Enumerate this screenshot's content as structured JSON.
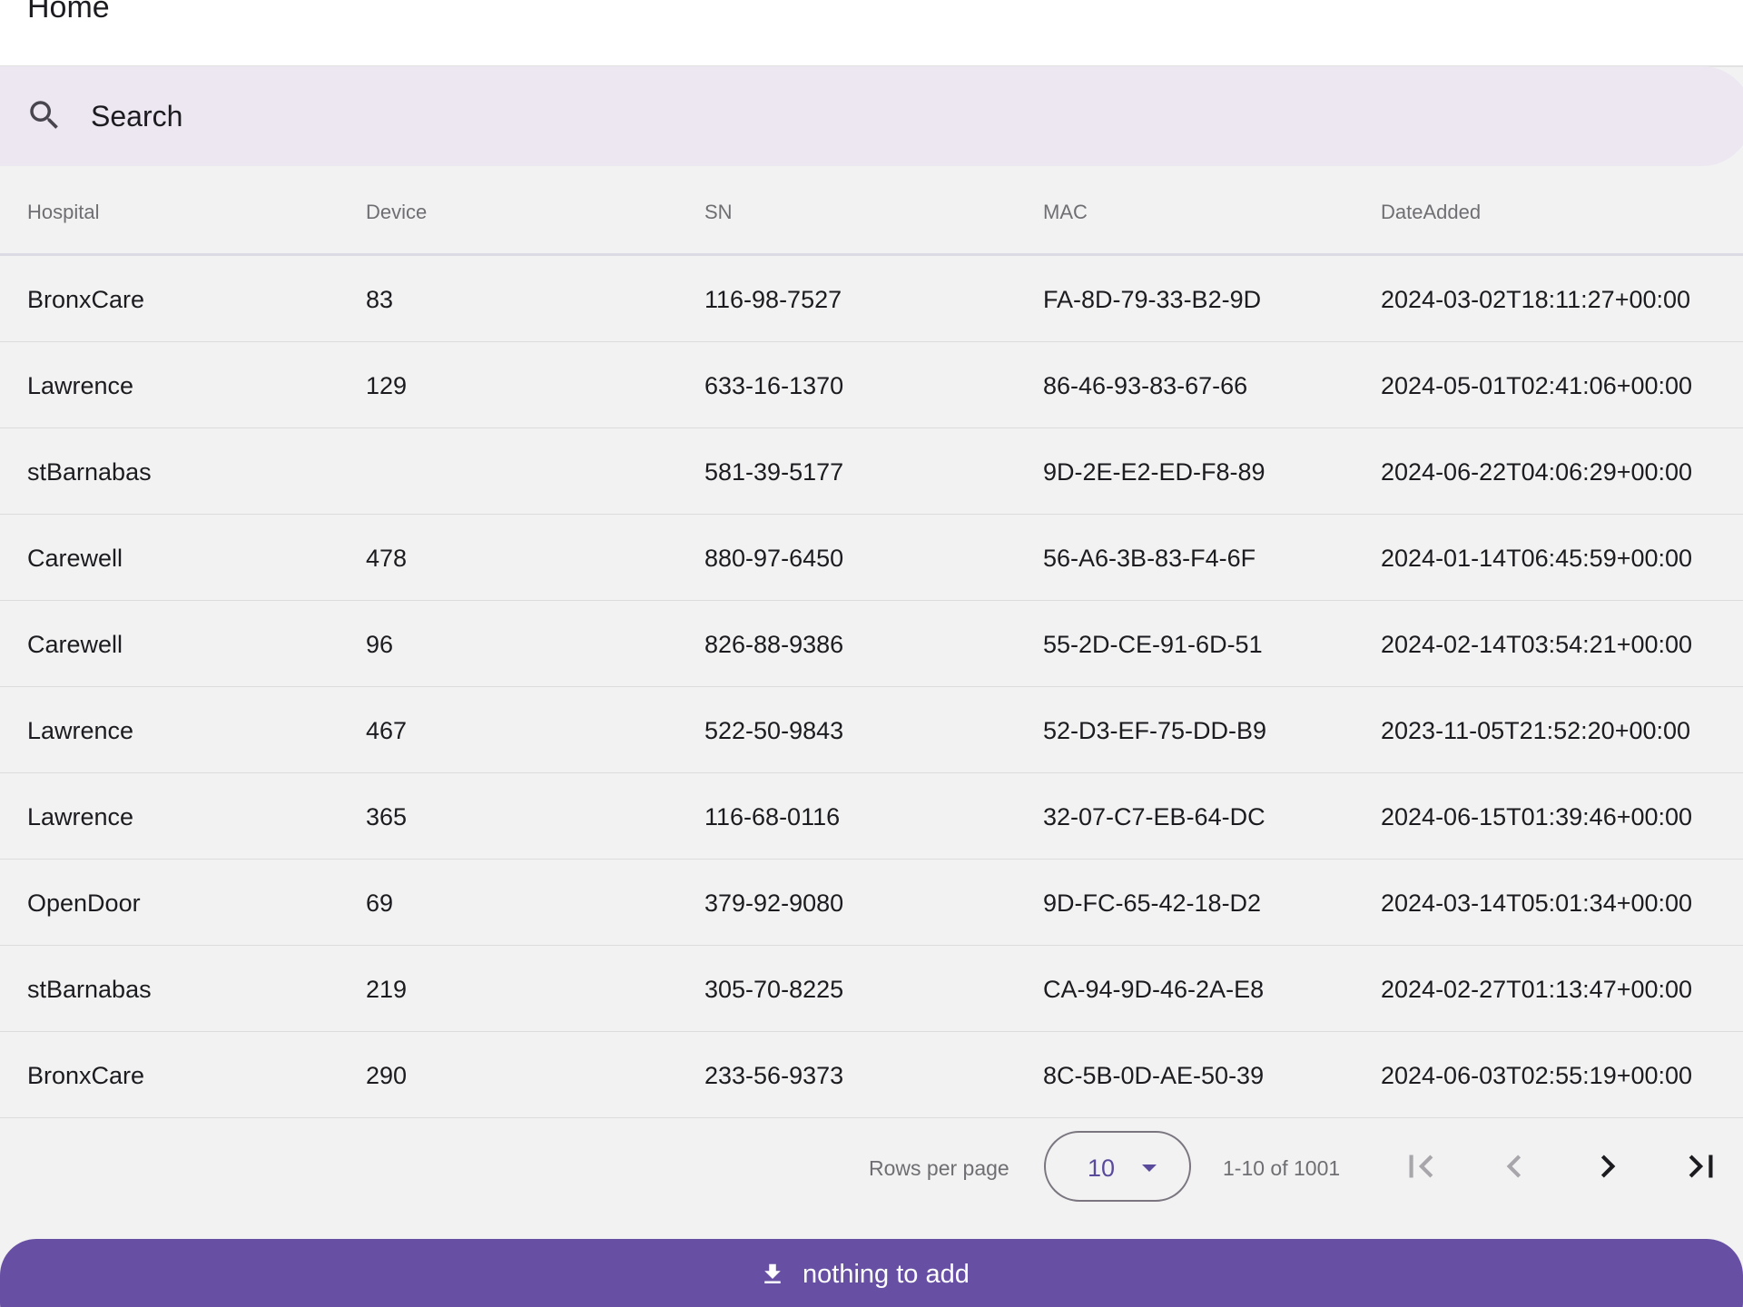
{
  "appbar": {
    "title": "Home"
  },
  "search": {
    "placeholder": "Search",
    "value": ""
  },
  "table": {
    "columns": [
      "Hospital",
      "Device",
      "SN",
      "MAC",
      "DateAdded"
    ],
    "rows": [
      [
        "BronxCare",
        "83",
        "116-98-7527",
        "FA-8D-79-33-B2-9D",
        "2024-03-02T18:11:27+00:00"
      ],
      [
        "Lawrence",
        "129",
        "633-16-1370",
        "86-46-93-83-67-66",
        "2024-05-01T02:41:06+00:00"
      ],
      [
        "stBarnabas",
        "",
        "581-39-5177",
        "9D-2E-E2-ED-F8-89",
        "2024-06-22T04:06:29+00:00"
      ],
      [
        "Carewell",
        "478",
        "880-97-6450",
        "56-A6-3B-83-F4-6F",
        "2024-01-14T06:45:59+00:00"
      ],
      [
        "Carewell",
        "96",
        "826-88-9386",
        "55-2D-CE-91-6D-51",
        "2024-02-14T03:54:21+00:00"
      ],
      [
        "Lawrence",
        "467",
        "522-50-9843",
        "52-D3-EF-75-DD-B9",
        "2023-11-05T21:52:20+00:00"
      ],
      [
        "Lawrence",
        "365",
        "116-68-0116",
        "32-07-C7-EB-64-DC",
        "2024-06-15T01:39:46+00:00"
      ],
      [
        "OpenDoor",
        "69",
        "379-92-9080",
        "9D-FC-65-42-18-D2",
        "2024-03-14T05:01:34+00:00"
      ],
      [
        "stBarnabas",
        "219",
        "305-70-8225",
        "CA-94-9D-46-2A-E8",
        "2024-02-27T01:13:47+00:00"
      ],
      [
        "BronxCare",
        "290",
        "233-56-9373",
        "8C-5B-0D-AE-50-39",
        "2024-06-03T02:55:19+00:00"
      ]
    ]
  },
  "pagination": {
    "rows_per_page_label": "Rows per page",
    "rows_per_page_value": "10",
    "range_text": "1-10 of 1001",
    "icons": [
      "first-page-icon",
      "previous-page-icon",
      "next-page-icon",
      "last-page-icon"
    ]
  },
  "action": {
    "label": "nothing to add",
    "icon": "download-icon"
  },
  "colors": {
    "accent": "#6750a4",
    "search_bg": "#ede7f2",
    "surface": "#f2f2f2",
    "muted_text": "#6f6f73"
  }
}
